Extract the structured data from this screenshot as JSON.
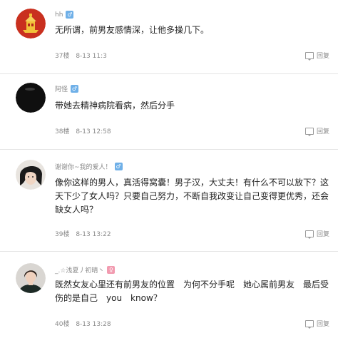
{
  "comments": [
    {
      "username": "hh",
      "gender": "male",
      "gender_icon": "male-icon",
      "text": "无所谓，前男友感情深，让他多操几下。",
      "floor": "37楼",
      "time": "8-13 11:3",
      "reply_label": "回复"
    },
    {
      "username": "阿怪",
      "gender": "male",
      "gender_icon": "male-icon",
      "text": "带她去精神病院看病，然后分手",
      "floor": "38楼",
      "time": "8-13 12:58",
      "reply_label": "回复"
    },
    {
      "username": "谢谢你~我的爱人！",
      "gender": "male",
      "gender_icon": "male-icon",
      "text": "像你这样的男人，真活得窝囊！男子汉，大丈夫！有什么不可以放下？这天下少了女人吗？只要自己努力，不断自我改变让自己变得更优秀，还会缺女人吗？",
      "floor": "39楼",
      "time": "8-13 13:22",
      "reply_label": "回复"
    },
    {
      "username": "_.☆浅夏丿初晴丶",
      "gender": "female",
      "gender_icon": "female-icon",
      "text": "既然女友心里还有前男友的位置　为何不分手呢　她心属前男友　最后受伤的是自己　you　know？",
      "floor": "40楼",
      "time": "8-13 13:28",
      "reply_label": "回复"
    }
  ],
  "colors": {
    "meta": "#8a8a8a",
    "male_badge": "#6fb0e8",
    "female_badge": "#f29bb0",
    "divider": "#e4e4e4"
  }
}
